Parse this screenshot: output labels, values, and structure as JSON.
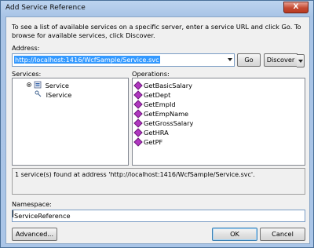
{
  "window": {
    "title": "Add Service Reference",
    "close_label": "X"
  },
  "intro_text": "To see a list of available services on a specific server, enter a service URL and click Go. To browse for available services, click Discover.",
  "address": {
    "label": "Address:",
    "value": "http://localhost:1416/WcfSample/Service.svc"
  },
  "buttons": {
    "go": "Go",
    "discover": "Discover",
    "advanced": "Advanced...",
    "ok": "OK",
    "cancel": "Cancel"
  },
  "services": {
    "label": "Services:",
    "items": [
      {
        "label": "Service",
        "level": 0,
        "icon": "service-icon"
      },
      {
        "label": "IService",
        "level": 1,
        "icon": "interface-icon"
      }
    ]
  },
  "operations": {
    "label": "Operations:",
    "items": [
      "GetBasicSalary",
      "GetDept",
      "GetEmpId",
      "GetEmpName",
      "GetGrossSalary",
      "GetHRA",
      "GetPF"
    ]
  },
  "status_text": "1 service(s) found at address 'http://localhost:1416/WcfSample/Service.svc'.",
  "namespace": {
    "label": "Namespace:",
    "value": "ServiceReference"
  },
  "colors": {
    "title_bar": "#bcd4ef",
    "close_button": "#c54a32",
    "selection": "#3399ff",
    "operation_icon": "#b036c0"
  }
}
